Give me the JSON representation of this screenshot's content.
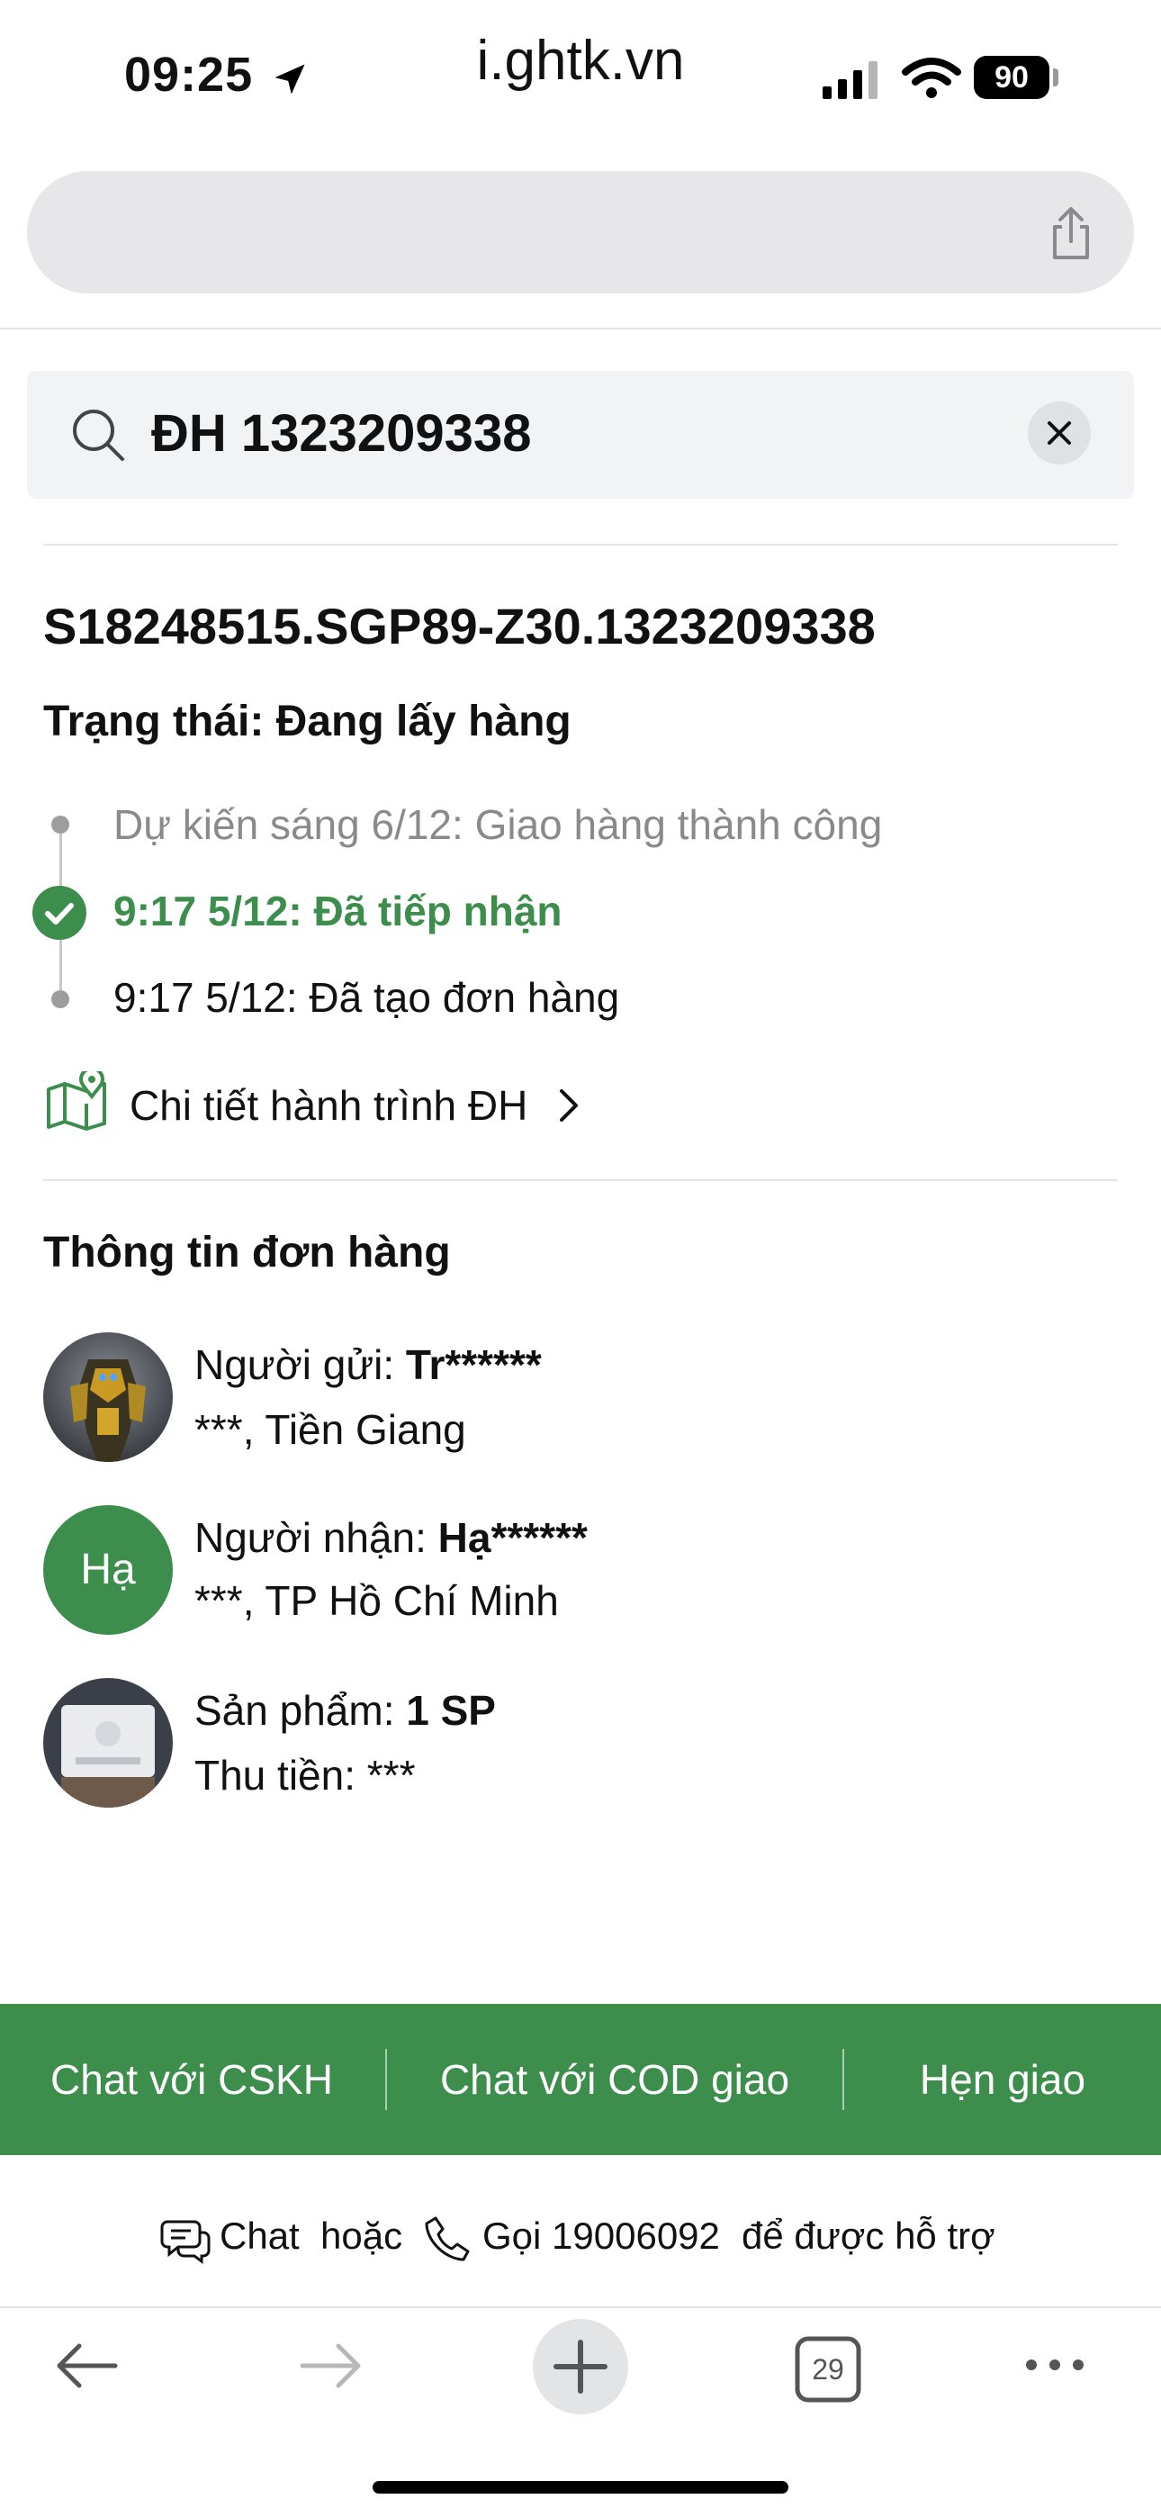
{
  "status_bar": {
    "time": "09:25",
    "battery": "90"
  },
  "browser": {
    "url": "i.ghtk.vn",
    "tab_count": "29"
  },
  "search": {
    "query": "ĐH 1323209338"
  },
  "order": {
    "code": "S18248515.SGP89-Z30.1323209338",
    "status": "Trạng thái: Đang lấy hàng",
    "timeline": [
      {
        "text": "Dự kiến sáng 6/12: Giao hàng thành công",
        "state": "upcoming"
      },
      {
        "text": "9:17 5/12: Đã tiếp nhận",
        "state": "current"
      },
      {
        "text": "9:17 5/12: Đã tạo đơn hàng",
        "state": "done"
      }
    ],
    "detail_link": "Chi tiết hành trình ĐH"
  },
  "info": {
    "title": "Thông tin đơn hàng",
    "sender": {
      "label": "Người gửi: ",
      "name": "Tr******",
      "address": "***, Tiền Giang"
    },
    "receiver": {
      "avatar_text": "Hạ",
      "label": "Người nhận: ",
      "name": "Hạ******",
      "address": "***, TP Hồ Chí Minh"
    },
    "product": {
      "label": "Sản phẩm: ",
      "value": "1 SP",
      "cod": "Thu tiền: ***"
    }
  },
  "actions": {
    "chat_cskh": "Chat với CSKH",
    "chat_cod": "Chat với COD giao",
    "schedule": "Hẹn giao"
  },
  "support": {
    "chat": "Chat",
    "or": "hoặc",
    "call": "Gọi 19006092",
    "suffix": "để được hỗ trợ"
  },
  "colors": {
    "brand_green": "#3d8d4d",
    "url_bar": "#e7e7ea"
  }
}
